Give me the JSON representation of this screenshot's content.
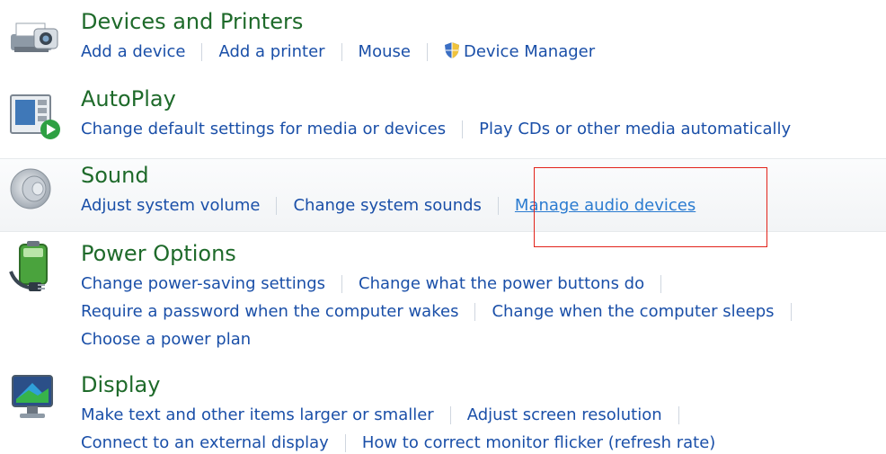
{
  "categories": {
    "devices": {
      "title": "Devices and Printers",
      "icon": "printer-camera-icon",
      "links": [
        "Add a device",
        "Add a printer",
        "Mouse",
        "Device Manager"
      ]
    },
    "autoplay": {
      "title": "AutoPlay",
      "icon": "autoplay-icon",
      "links": [
        "Change default settings for media or devices",
        "Play CDs or other media automatically"
      ]
    },
    "sound": {
      "title": "Sound",
      "icon": "speaker-icon",
      "links": [
        "Adjust system volume",
        "Change system sounds",
        "Manage audio devices"
      ]
    },
    "power": {
      "title": "Power Options",
      "icon": "battery-plug-icon",
      "links": [
        "Change power-saving settings",
        "Change what the power buttons do",
        "Require a password when the computer wakes",
        "Change when the computer sleeps",
        "Choose a power plan"
      ]
    },
    "display": {
      "title": "Display",
      "icon": "monitor-icon",
      "links": [
        "Make text and other items larger or smaller",
        "Adjust screen resolution",
        "Connect to an external display",
        "How to correct monitor flicker (refresh rate)"
      ]
    }
  },
  "colors": {
    "title": "#1e6a2a",
    "link": "#1a4fa8",
    "active_link": "#2b7bd0",
    "highlight_box": "#e2231a"
  }
}
